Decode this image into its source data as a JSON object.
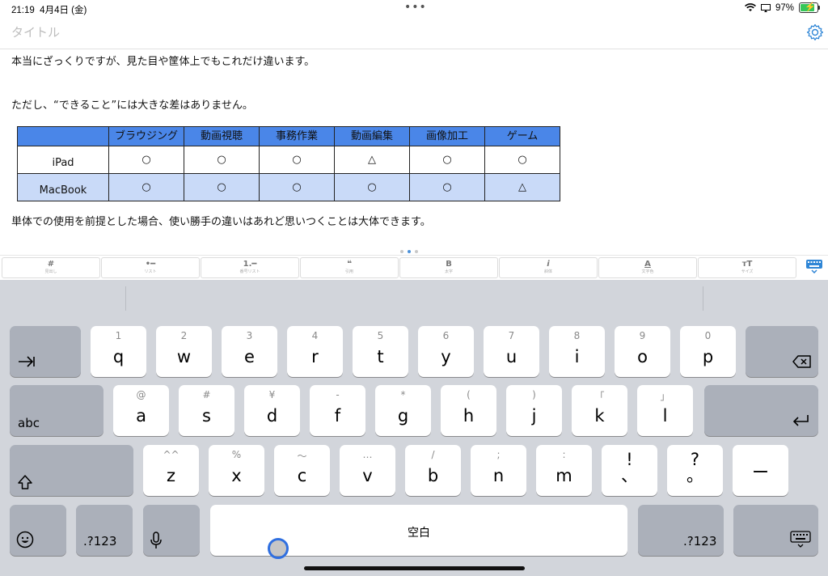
{
  "status_bar": {
    "time": "21:19",
    "date": "4月4日 (金)",
    "battery": "97%",
    "battery_level": 0.97
  },
  "title": {
    "placeholder": "タイトル"
  },
  "body": {
    "p1": "本当にざっくりですが、見た目や筐体上でもこれだけ違います。",
    "p2": "ただし、“できること”には大きな差はありません。",
    "p3": "単体での使用を前提とした場合、使い勝手の違いはあれど思いつくことは大体できます。"
  },
  "table": {
    "headers": [
      "",
      "ブラウジング",
      "動画視聴",
      "事務作業",
      "動画編集",
      "画像加工",
      "ゲーム"
    ],
    "rows": [
      {
        "label": "iPad",
        "cells": [
          "○",
          "○",
          "○",
          "△",
          "○",
          "○"
        ]
      },
      {
        "label": "MacBook",
        "cells": [
          "○",
          "○",
          "○",
          "○",
          "○",
          "△"
        ]
      }
    ],
    "header_color": "#4a86e8",
    "alt_row_color": "#c9daf8"
  },
  "toolbar": {
    "buttons": [
      {
        "symbol": "#",
        "caption": "見出し"
      },
      {
        "symbol": "•━",
        "caption": "リスト"
      },
      {
        "symbol": "1.━",
        "caption": "番号リスト"
      },
      {
        "symbol": "❝",
        "caption": "引用"
      },
      {
        "symbol": "B",
        "caption": "太字"
      },
      {
        "symbol": "i",
        "caption": "斜体"
      },
      {
        "symbol": "A",
        "caption": "文字色"
      },
      {
        "symbol": "ᴛT",
        "caption": "サイズ"
      }
    ]
  },
  "keyboard": {
    "row1": [
      {
        "hint": "1",
        "key": "q"
      },
      {
        "hint": "2",
        "key": "w"
      },
      {
        "hint": "3",
        "key": "e"
      },
      {
        "hint": "4",
        "key": "r"
      },
      {
        "hint": "5",
        "key": "t"
      },
      {
        "hint": "6",
        "key": "y"
      },
      {
        "hint": "7",
        "key": "u"
      },
      {
        "hint": "8",
        "key": "i"
      },
      {
        "hint": "9",
        "key": "o"
      },
      {
        "hint": "0",
        "key": "p"
      }
    ],
    "row2": [
      {
        "hint": "@",
        "key": "a"
      },
      {
        "hint": "#",
        "key": "s"
      },
      {
        "hint": "¥",
        "key": "d"
      },
      {
        "hint": "-",
        "key": "f"
      },
      {
        "hint": "*",
        "key": "g"
      },
      {
        "hint": "(",
        "key": "h"
      },
      {
        "hint": ")",
        "key": "j"
      },
      {
        "hint": "「",
        "key": "k"
      },
      {
        "hint": "」",
        "key": "l"
      }
    ],
    "row3": [
      {
        "hint": "^^",
        "key": "z"
      },
      {
        "hint": "%",
        "key": "x"
      },
      {
        "hint": "〜",
        "key": "c"
      },
      {
        "hint": "…",
        "key": "v"
      },
      {
        "hint": "/",
        "key": "b"
      },
      {
        "hint": ";",
        "key": "n"
      },
      {
        "hint": ":",
        "key": "m"
      },
      {
        "hint": "",
        "key": "!\n、"
      },
      {
        "hint": "",
        "key": "?\n。"
      },
      {
        "hint": "",
        "key": "ー"
      }
    ],
    "abc_label": "abc",
    "num_label": ".?123",
    "space_label": "空白",
    "accent_color": "#2f6fe0"
  }
}
